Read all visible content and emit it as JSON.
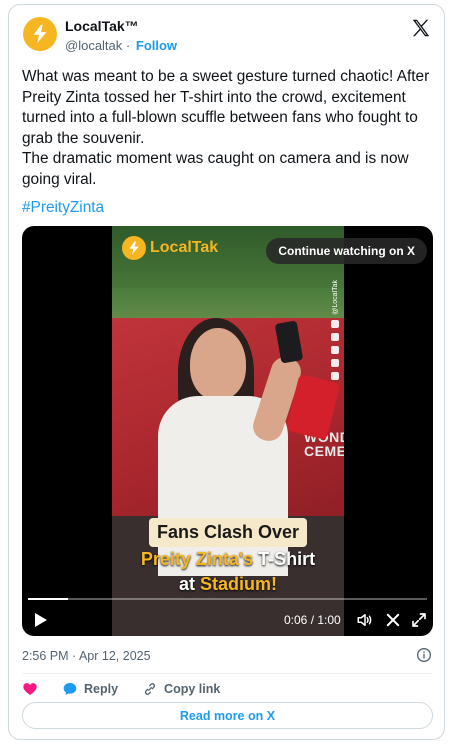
{
  "author": {
    "name": "LocalTak™",
    "handle": "@localtak",
    "separator": "·",
    "follow_label": "Follow"
  },
  "tweet": {
    "paragraphs": [
      "What was meant to be a sweet gesture turned chaotic! After Preity Zinta tossed her T-shirt into the crowd, excitement turned into a full-blown scuffle between fans who fought to grab the souvenir.",
      "The dramatic moment was caught on camera and is now going viral."
    ],
    "hashtag": "#PreityZinta"
  },
  "video": {
    "continue_label": "Continue watching on X",
    "overlay_brand": "LocalTak",
    "side_handle": "@LocalTak",
    "wall_text_1": "WONDE",
    "wall_text_2": "CEMEN",
    "caption_line1": "Fans Clash Over",
    "caption_line2_a": "Preity Zinta's",
    "caption_line2_b": " T-Shirt",
    "caption_line3_a": "at ",
    "caption_line3_b": "Stadium!",
    "time_display": "0:06 / 1:00",
    "progress": 0.1,
    "icons": [
      "play-icon",
      "volume-icon",
      "close-icon",
      "fullscreen-icon"
    ]
  },
  "meta": {
    "timestamp": "2:56 PM · Apr 12, 2025"
  },
  "actions": {
    "like_icon": "heart-icon",
    "reply_label": "Reply",
    "copy_label": "Copy link"
  },
  "read_more_label": "Read more on X",
  "colors": {
    "accent": "#1d9bf0",
    "brand": "#f6b622",
    "like": "#f91880",
    "muted": "#536471"
  }
}
